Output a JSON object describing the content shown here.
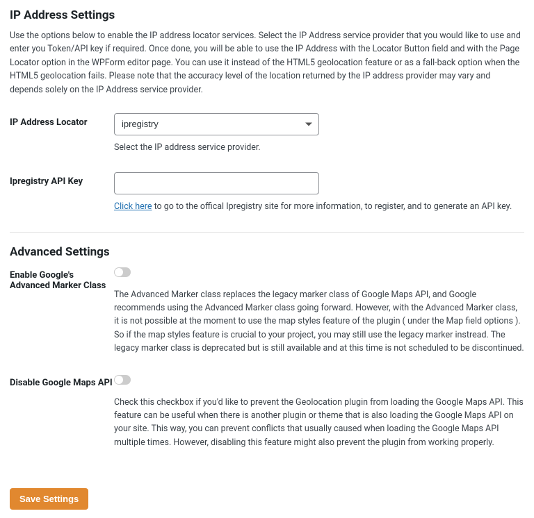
{
  "section1": {
    "heading": "IP Address Settings",
    "description": "Use the options below to enable the IP address locator services. Select the IP Address service provider that you would like to use and enter you Token/API key if required. Once done, you will be able to use the IP Address with the Locator Button field and with the Page Locator option in the WPForm editor page. You can use it instead of the HTML5 geolocation feature or as a fall-back option when the HTML5 geolocation fails. Please note that the accuracy level of the location returned by the IP address provider may vary and depends solely on the IP Address service provider."
  },
  "locator": {
    "label": "IP Address Locator",
    "selected": "ipregistry",
    "help": "Select the IP address service provider."
  },
  "apikey": {
    "label": "Ipregistry API Key",
    "value": "",
    "link_text": "Click here",
    "help_suffix": " to go to the offical Ipregistry site for more information, to register, and to generate an API key."
  },
  "section2": {
    "heading": "Advanced Settings"
  },
  "advanced_marker": {
    "label": "Enable Google's Advanced Marker Class",
    "enabled": false,
    "description": "The Advanced Marker class replaces the legacy marker class of Google Maps API, and Google recommends using the Advanced Marker class going forward. However, with the Advanced Marker class, it is not possible at the moment to use the map styles feature of the plugin ( under the Map field options ). So if the map styles feature is crucial to your project, you may still use the legacy marker instread. The legacy marker class is deprecated but is still available and at this time is not scheduled to be discontinued."
  },
  "disable_api": {
    "label": "Disable Google Maps API",
    "enabled": false,
    "description": "Check this checkbox if you'd like to prevent the Geolocation plugin from loading the Google Maps API. This feature can be useful when there is another plugin or theme that is also loading the Google Maps API on your site. This way, you can prevent conflicts that usually caused when loading the Google Maps API multiple times. However, disabling this feature might also prevent the plugin from working properly."
  },
  "save": {
    "label": "Save Settings"
  }
}
